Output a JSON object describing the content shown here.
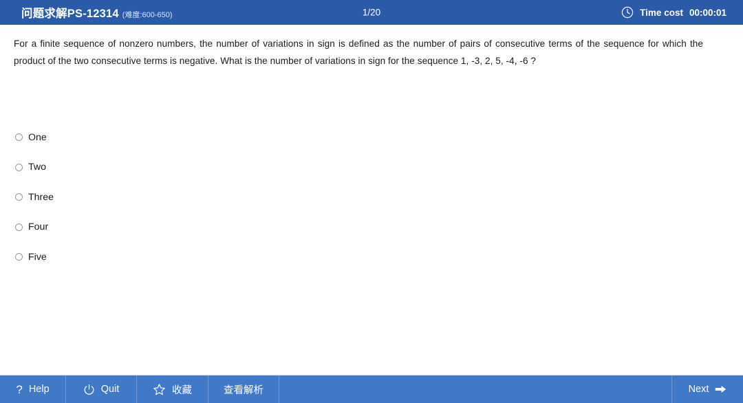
{
  "header": {
    "title_main": "问题求解PS-12314",
    "title_difficulty": "(难度:600-650)",
    "progress": "1/20",
    "time_label": "Time cost",
    "time_value": "00:00:01",
    "clock_icon": "clock-icon",
    "bg_color": "#2B5BA8"
  },
  "question": {
    "text": "For a finite sequence of nonzero numbers, the number of variations in sign is defined as the number of pairs of consecutive terms of the sequence for which the product of the two consecutive terms is negative. What is the number of variations in sign for the sequence 1, -3, 2, 5, -4, -6 ?"
  },
  "options": [
    {
      "label": "One",
      "selected": false
    },
    {
      "label": "Two",
      "selected": false
    },
    {
      "label": "Three",
      "selected": false
    },
    {
      "label": "Four",
      "selected": false
    },
    {
      "label": "Five",
      "selected": false
    }
  ],
  "footer": {
    "bg_color": "#4179C8",
    "help_label": "Help",
    "help_icon": "question-mark-icon",
    "quit_label": "Quit",
    "quit_icon": "power-icon",
    "favorite_label": "收藏",
    "favorite_icon": "star-icon",
    "explanation_label": "查看解析",
    "next_label": "Next",
    "next_icon": "arrow-right-icon"
  }
}
